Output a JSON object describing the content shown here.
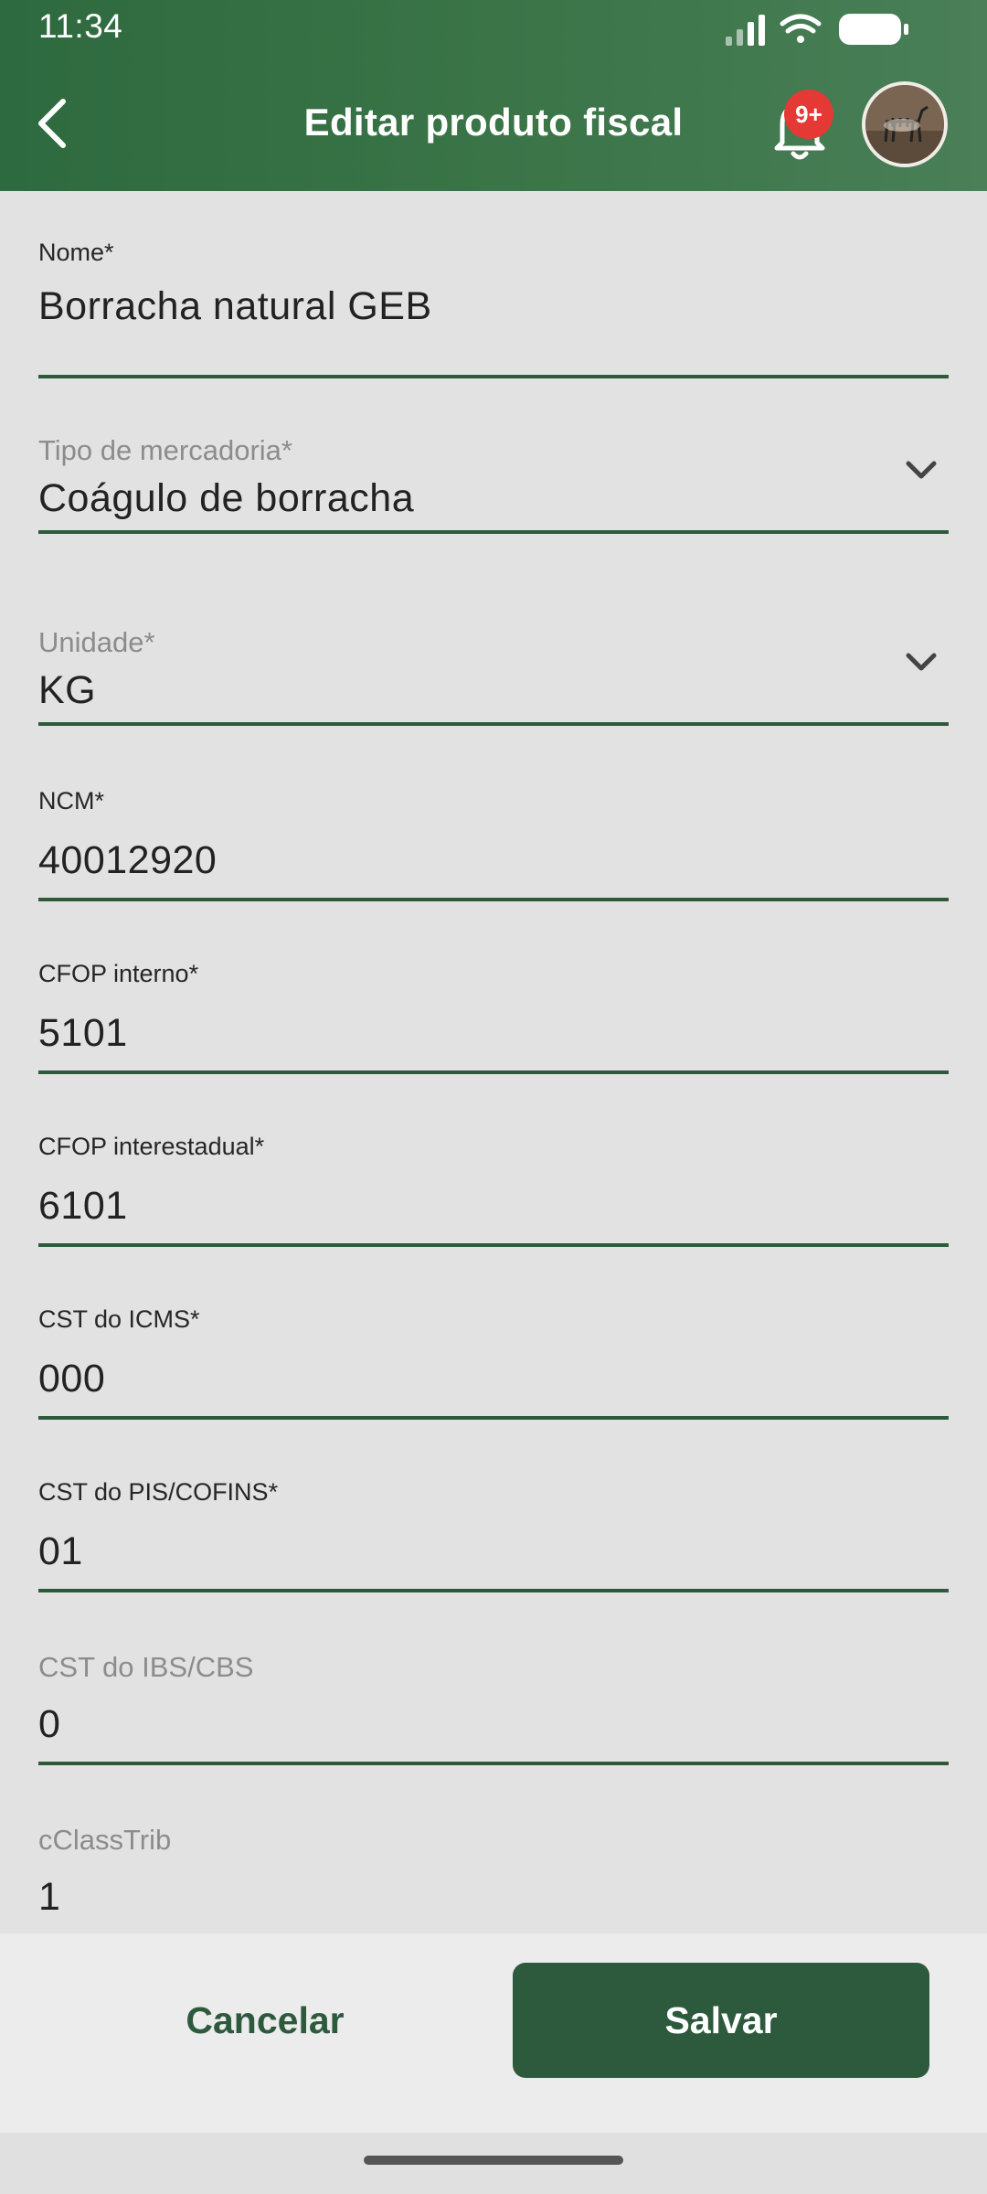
{
  "status_bar": {
    "time": "11:34",
    "icons": [
      "signal-icon",
      "wifi-icon",
      "battery-icon"
    ]
  },
  "header": {
    "title": "Editar produto fiscal",
    "notification_badge": "9+",
    "back_icon": "chevron-left-icon",
    "bell_icon": "bell-icon",
    "avatar": "zebra-avatar"
  },
  "form": {
    "nome": {
      "label": "Nome*",
      "value": "Borracha natural GEB"
    },
    "tipo_mercadoria": {
      "label": "Tipo de mercadoria*",
      "value": "Coágulo de borracha"
    },
    "unidade": {
      "label": "Unidade*",
      "value": "KG"
    },
    "ncm": {
      "label": "NCM*",
      "value": "40012920"
    },
    "cfop_interno": {
      "label": "CFOP interno*",
      "value": "5101"
    },
    "cfop_interestadual": {
      "label": "CFOP interestadual*",
      "value": "6101"
    },
    "cst_icms": {
      "label": "CST do ICMS*",
      "value": "000"
    },
    "cst_pis_cofins": {
      "label": "CST do PIS/COFINS*",
      "value": "01"
    },
    "cst_ibs_cbs": {
      "label": "CST do IBS/CBS",
      "value": "0"
    },
    "cclasstrib": {
      "label": "cClassTrib",
      "value": "1"
    }
  },
  "actions": {
    "cancel_label": "Cancelar",
    "save_label": "Salvar"
  },
  "colors": {
    "header_green": "#3b7548",
    "accent_dark_green": "#2d5a3d",
    "badge_red": "#e53935",
    "background": "#e2e2e2"
  }
}
